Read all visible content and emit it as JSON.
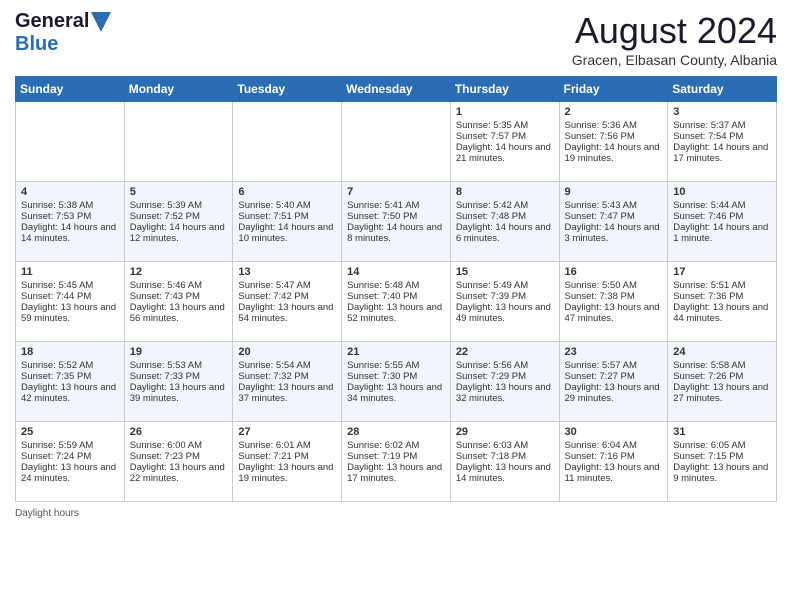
{
  "header": {
    "logo_general": "General",
    "logo_blue": "Blue",
    "month_title": "August 2024",
    "location": "Gracen, Elbasan County, Albania"
  },
  "days_of_week": [
    "Sunday",
    "Monday",
    "Tuesday",
    "Wednesday",
    "Thursday",
    "Friday",
    "Saturday"
  ],
  "weeks": [
    [
      {
        "day": "",
        "sunrise": "",
        "sunset": "",
        "daylight": ""
      },
      {
        "day": "",
        "sunrise": "",
        "sunset": "",
        "daylight": ""
      },
      {
        "day": "",
        "sunrise": "",
        "sunset": "",
        "daylight": ""
      },
      {
        "day": "",
        "sunrise": "",
        "sunset": "",
        "daylight": ""
      },
      {
        "day": "1",
        "sunrise": "Sunrise: 5:35 AM",
        "sunset": "Sunset: 7:57 PM",
        "daylight": "Daylight: 14 hours and 21 minutes."
      },
      {
        "day": "2",
        "sunrise": "Sunrise: 5:36 AM",
        "sunset": "Sunset: 7:56 PM",
        "daylight": "Daylight: 14 hours and 19 minutes."
      },
      {
        "day": "3",
        "sunrise": "Sunrise: 5:37 AM",
        "sunset": "Sunset: 7:54 PM",
        "daylight": "Daylight: 14 hours and 17 minutes."
      }
    ],
    [
      {
        "day": "4",
        "sunrise": "Sunrise: 5:38 AM",
        "sunset": "Sunset: 7:53 PM",
        "daylight": "Daylight: 14 hours and 14 minutes."
      },
      {
        "day": "5",
        "sunrise": "Sunrise: 5:39 AM",
        "sunset": "Sunset: 7:52 PM",
        "daylight": "Daylight: 14 hours and 12 minutes."
      },
      {
        "day": "6",
        "sunrise": "Sunrise: 5:40 AM",
        "sunset": "Sunset: 7:51 PM",
        "daylight": "Daylight: 14 hours and 10 minutes."
      },
      {
        "day": "7",
        "sunrise": "Sunrise: 5:41 AM",
        "sunset": "Sunset: 7:50 PM",
        "daylight": "Daylight: 14 hours and 8 minutes."
      },
      {
        "day": "8",
        "sunrise": "Sunrise: 5:42 AM",
        "sunset": "Sunset: 7:48 PM",
        "daylight": "Daylight: 14 hours and 6 minutes."
      },
      {
        "day": "9",
        "sunrise": "Sunrise: 5:43 AM",
        "sunset": "Sunset: 7:47 PM",
        "daylight": "Daylight: 14 hours and 3 minutes."
      },
      {
        "day": "10",
        "sunrise": "Sunrise: 5:44 AM",
        "sunset": "Sunset: 7:46 PM",
        "daylight": "Daylight: 14 hours and 1 minute."
      }
    ],
    [
      {
        "day": "11",
        "sunrise": "Sunrise: 5:45 AM",
        "sunset": "Sunset: 7:44 PM",
        "daylight": "Daylight: 13 hours and 59 minutes."
      },
      {
        "day": "12",
        "sunrise": "Sunrise: 5:46 AM",
        "sunset": "Sunset: 7:43 PM",
        "daylight": "Daylight: 13 hours and 56 minutes."
      },
      {
        "day": "13",
        "sunrise": "Sunrise: 5:47 AM",
        "sunset": "Sunset: 7:42 PM",
        "daylight": "Daylight: 13 hours and 54 minutes."
      },
      {
        "day": "14",
        "sunrise": "Sunrise: 5:48 AM",
        "sunset": "Sunset: 7:40 PM",
        "daylight": "Daylight: 13 hours and 52 minutes."
      },
      {
        "day": "15",
        "sunrise": "Sunrise: 5:49 AM",
        "sunset": "Sunset: 7:39 PM",
        "daylight": "Daylight: 13 hours and 49 minutes."
      },
      {
        "day": "16",
        "sunrise": "Sunrise: 5:50 AM",
        "sunset": "Sunset: 7:38 PM",
        "daylight": "Daylight: 13 hours and 47 minutes."
      },
      {
        "day": "17",
        "sunrise": "Sunrise: 5:51 AM",
        "sunset": "Sunset: 7:36 PM",
        "daylight": "Daylight: 13 hours and 44 minutes."
      }
    ],
    [
      {
        "day": "18",
        "sunrise": "Sunrise: 5:52 AM",
        "sunset": "Sunset: 7:35 PM",
        "daylight": "Daylight: 13 hours and 42 minutes."
      },
      {
        "day": "19",
        "sunrise": "Sunrise: 5:53 AM",
        "sunset": "Sunset: 7:33 PM",
        "daylight": "Daylight: 13 hours and 39 minutes."
      },
      {
        "day": "20",
        "sunrise": "Sunrise: 5:54 AM",
        "sunset": "Sunset: 7:32 PM",
        "daylight": "Daylight: 13 hours and 37 minutes."
      },
      {
        "day": "21",
        "sunrise": "Sunrise: 5:55 AM",
        "sunset": "Sunset: 7:30 PM",
        "daylight": "Daylight: 13 hours and 34 minutes."
      },
      {
        "day": "22",
        "sunrise": "Sunrise: 5:56 AM",
        "sunset": "Sunset: 7:29 PM",
        "daylight": "Daylight: 13 hours and 32 minutes."
      },
      {
        "day": "23",
        "sunrise": "Sunrise: 5:57 AM",
        "sunset": "Sunset: 7:27 PM",
        "daylight": "Daylight: 13 hours and 29 minutes."
      },
      {
        "day": "24",
        "sunrise": "Sunrise: 5:58 AM",
        "sunset": "Sunset: 7:26 PM",
        "daylight": "Daylight: 13 hours and 27 minutes."
      }
    ],
    [
      {
        "day": "25",
        "sunrise": "Sunrise: 5:59 AM",
        "sunset": "Sunset: 7:24 PM",
        "daylight": "Daylight: 13 hours and 24 minutes."
      },
      {
        "day": "26",
        "sunrise": "Sunrise: 6:00 AM",
        "sunset": "Sunset: 7:23 PM",
        "daylight": "Daylight: 13 hours and 22 minutes."
      },
      {
        "day": "27",
        "sunrise": "Sunrise: 6:01 AM",
        "sunset": "Sunset: 7:21 PM",
        "daylight": "Daylight: 13 hours and 19 minutes."
      },
      {
        "day": "28",
        "sunrise": "Sunrise: 6:02 AM",
        "sunset": "Sunset: 7:19 PM",
        "daylight": "Daylight: 13 hours and 17 minutes."
      },
      {
        "day": "29",
        "sunrise": "Sunrise: 6:03 AM",
        "sunset": "Sunset: 7:18 PM",
        "daylight": "Daylight: 13 hours and 14 minutes."
      },
      {
        "day": "30",
        "sunrise": "Sunrise: 6:04 AM",
        "sunset": "Sunset: 7:16 PM",
        "daylight": "Daylight: 13 hours and 11 minutes."
      },
      {
        "day": "31",
        "sunrise": "Sunrise: 6:05 AM",
        "sunset": "Sunset: 7:15 PM",
        "daylight": "Daylight: 13 hours and 9 minutes."
      }
    ]
  ],
  "footer": {
    "note": "Daylight hours"
  }
}
